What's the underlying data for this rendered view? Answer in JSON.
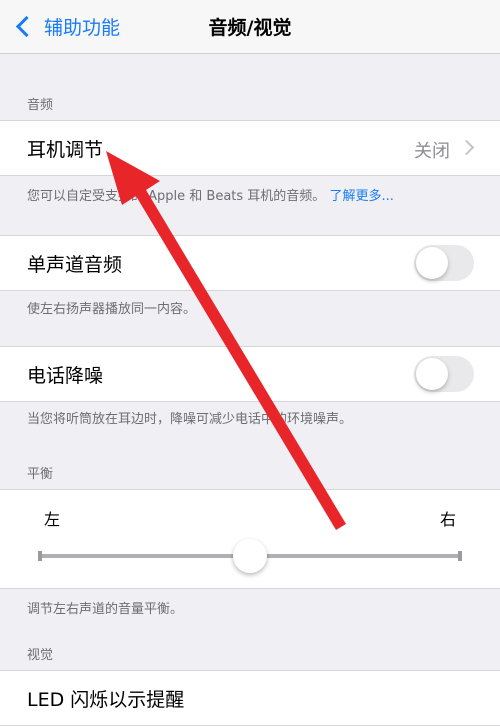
{
  "nav": {
    "back_label": "辅助功能",
    "title": "音频/视觉"
  },
  "audio_section": {
    "header": "音频",
    "headphone": {
      "label": "耳机调节",
      "value": "关闭",
      "footer": "您可以自定受支持的 Apple 和 Beats 耳机的音频。",
      "footer_link": "了解更多..."
    },
    "mono": {
      "label": "单声道音频",
      "on": false,
      "footer": "使左右扬声器播放同一内容。"
    },
    "noise": {
      "label": "电话降噪",
      "on": false,
      "footer": "当您将听筒放在耳边时，降噪可减少电话中的环境噪声。"
    }
  },
  "balance_section": {
    "header": "平衡",
    "left_label": "左",
    "right_label": "右",
    "value_fraction": 0.5,
    "footer": "调节左右声道的音量平衡。"
  },
  "visual_section": {
    "header": "视觉",
    "led": {
      "label": "LED 闪烁以示提醒"
    }
  },
  "colors": {
    "accent": "#1a7cf5",
    "annotation_arrow": "#e8262a"
  }
}
